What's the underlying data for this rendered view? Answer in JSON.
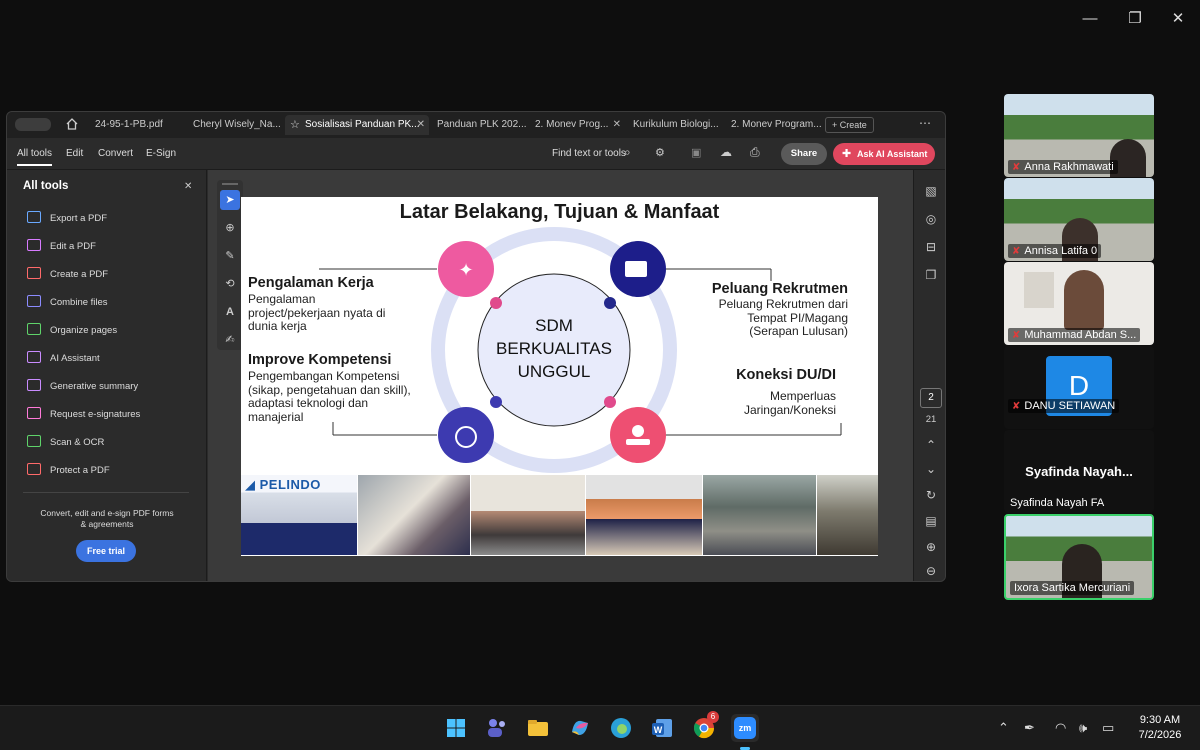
{
  "window_controls": {
    "minimize": "—",
    "maximize": "❐",
    "close": "✕"
  },
  "acrobat": {
    "tabs": [
      {
        "label": "24-95-1-PB.pdf"
      },
      {
        "label": "Cheryl Wisely_Na..."
      },
      {
        "label": "Sosialisasi Panduan PK..."
      },
      {
        "label": "Panduan PLK 202..."
      },
      {
        "label": "2. Monev Prog..."
      },
      {
        "label": "Kurikulum Biologi..."
      },
      {
        "label": "2. Monev Program..."
      }
    ],
    "create_label": "Create",
    "menu": [
      "All tools",
      "Edit",
      "Convert",
      "E-Sign"
    ],
    "find_label": "Find text or tools",
    "share_label": "Share",
    "ai_label": "Ask AI Assistant",
    "panel": {
      "title": "All tools",
      "items": [
        {
          "label": "Export a PDF",
          "color": "#6aa9ff"
        },
        {
          "label": "Edit a PDF",
          "color": "#d77bff"
        },
        {
          "label": "Create a PDF",
          "color": "#ff6a6a"
        },
        {
          "label": "Combine files",
          "color": "#8c8cff"
        },
        {
          "label": "Organize pages",
          "color": "#5fd36a"
        },
        {
          "label": "AI Assistant",
          "color": "#c98cff"
        },
        {
          "label": "Generative summary",
          "color": "#c98cff"
        },
        {
          "label": "Request e-signatures",
          "color": "#ff7ad9"
        },
        {
          "label": "Scan & OCR",
          "color": "#5fd36a"
        },
        {
          "label": "Protect a PDF",
          "color": "#ff6a6a"
        }
      ],
      "promo": "Convert, edit and e-sign PDF forms & agreements",
      "trial_label": "Free trial"
    },
    "page_current": "2",
    "page_total": "21"
  },
  "slide": {
    "title": "Latar Belakang, Tujuan & Manfaat",
    "center": [
      "SDM",
      "BERKUALITAS",
      "UNGGUL"
    ],
    "left1_head": "Pengalaman Kerja",
    "left1_text": [
      "Pengalaman",
      "project/pekerjaan nyata di",
      "dunia kerja"
    ],
    "left2_head": "Improve Kompetensi",
    "left2_text": [
      "Pengembangan Kompetensi",
      "(sikap, pengetahuan dan skill),",
      "adaptasi teknologi dan",
      "manajerial"
    ],
    "right1_head": "Peluang Rekrutmen",
    "right1_text": [
      "Peluang Rekrutmen dari",
      "Tempat PI/Magang",
      "(Serapan Lulusan)"
    ],
    "right2_head": "Koneksi DU/DI",
    "right2_text": [
      "Memperluas",
      "Jaringan/Koneksi"
    ],
    "logo": "PELINDO"
  },
  "participants": [
    {
      "name": "Anna Rakhmawati"
    },
    {
      "name": "Annisa Latifa 0"
    },
    {
      "name": "Muhammad Abdan S..."
    },
    {
      "name": "DANU SETIAWAN",
      "initial": "D"
    },
    {
      "name": "Syafinda  Nayah...",
      "sub": "Syafinda Nayah FA"
    },
    {
      "name": "Ixora Sartika Mercuriani"
    }
  ],
  "taskbar": {
    "time": "9:30 AM",
    "date": "7/2/2026",
    "zoom_label": "zm",
    "chrome_badge": "6"
  }
}
